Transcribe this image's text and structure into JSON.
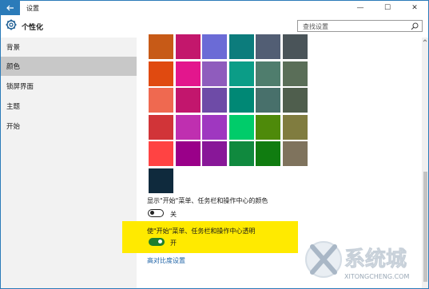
{
  "window": {
    "title": "设置",
    "back_icon": "arrow-left-icon"
  },
  "window_controls": {
    "minimize": "—",
    "maximize": "☐",
    "close": "✕"
  },
  "header": {
    "title": "个性化",
    "icon": "gear-icon"
  },
  "search": {
    "placeholder": "查找设置"
  },
  "sidebar": {
    "items": [
      {
        "label": "背景"
      },
      {
        "label": "颜色",
        "active": true
      },
      {
        "label": "锁屏界面"
      },
      {
        "label": "主题"
      },
      {
        "label": "开始"
      }
    ]
  },
  "accent_colors": [
    [
      "#c75a17",
      "#c3176c",
      "#6b6bd6",
      "#0c7c7c",
      "#525e74",
      "#4a5459"
    ],
    [
      "#e04a10",
      "#e3168d",
      "#8f5cbd",
      "#0b9d87",
      "#4f7d6d",
      "#5a6e58"
    ],
    [
      "#ef6950",
      "#c2166d",
      "#6e4ba7",
      "#008875",
      "#48706b",
      "#4f5e4d"
    ],
    [
      "#d13438",
      "#bf2fb0",
      "#9f37c0",
      "#00cc6a",
      "#4e8a0a",
      "#807c3f"
    ],
    [
      "#ff4343",
      "#9a0089",
      "#881798",
      "#10893e",
      "#107c10",
      "#7f735d"
    ],
    [
      "#0f2a3d"
    ]
  ],
  "settings": {
    "show_color_label": "显示\"开始\"菜单、任务栏和操作中心的颜色",
    "show_color_state": "关",
    "transparent_label": "使\"开始\"菜单、任务栏和操作中心透明",
    "transparent_state": "开",
    "high_contrast_link": "高对比度设置"
  },
  "colors": {
    "accent": "#2b7bb9",
    "toggle_on": "#1e7f2d",
    "highlight": "#ffea00",
    "link": "#1f63a6"
  }
}
